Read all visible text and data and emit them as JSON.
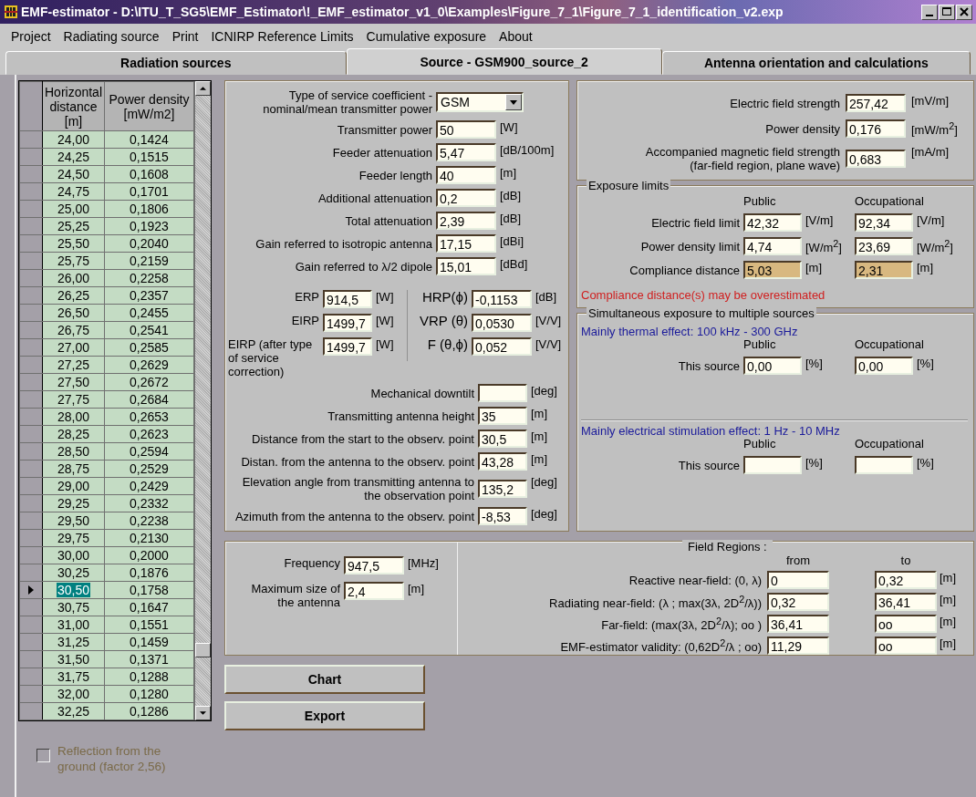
{
  "window": {
    "title": "EMF-estimator - D:\\ITU_T_SG5\\EMF_Estimator\\!_EMF_estimator_v1_0\\Examples\\Figure_7_1\\Figure_7_1_identification_v2.exp"
  },
  "menu": [
    "Project",
    "Radiating source",
    "Print",
    "ICNIRP Reference Limits",
    "Cumulative exposure",
    "About"
  ],
  "tabs": [
    {
      "label": "Radiation sources",
      "selected": false
    },
    {
      "label": "Source - GSM900_source_2",
      "selected": true
    },
    {
      "label": "Antenna orientation and calculations",
      "selected": false
    }
  ],
  "distance_table": {
    "columns": [
      "Horizontal distance [m]",
      "Power density [mW/m2]"
    ],
    "rows": [
      {
        "distance": "24,00",
        "power_density": "0,1424",
        "selected": false
      },
      {
        "distance": "24,25",
        "power_density": "0,1515",
        "selected": false
      },
      {
        "distance": "24,50",
        "power_density": "0,1608",
        "selected": false
      },
      {
        "distance": "24,75",
        "power_density": "0,1701",
        "selected": false
      },
      {
        "distance": "25,00",
        "power_density": "0,1806",
        "selected": false
      },
      {
        "distance": "25,25",
        "power_density": "0,1923",
        "selected": false
      },
      {
        "distance": "25,50",
        "power_density": "0,2040",
        "selected": false
      },
      {
        "distance": "25,75",
        "power_density": "0,2159",
        "selected": false
      },
      {
        "distance": "26,00",
        "power_density": "0,2258",
        "selected": false
      },
      {
        "distance": "26,25",
        "power_density": "0,2357",
        "selected": false
      },
      {
        "distance": "26,50",
        "power_density": "0,2455",
        "selected": false
      },
      {
        "distance": "26,75",
        "power_density": "0,2541",
        "selected": false
      },
      {
        "distance": "27,00",
        "power_density": "0,2585",
        "selected": false
      },
      {
        "distance": "27,25",
        "power_density": "0,2629",
        "selected": false
      },
      {
        "distance": "27,50",
        "power_density": "0,2672",
        "selected": false
      },
      {
        "distance": "27,75",
        "power_density": "0,2684",
        "selected": false
      },
      {
        "distance": "28,00",
        "power_density": "0,2653",
        "selected": false
      },
      {
        "distance": "28,25",
        "power_density": "0,2623",
        "selected": false
      },
      {
        "distance": "28,50",
        "power_density": "0,2594",
        "selected": false
      },
      {
        "distance": "28,75",
        "power_density": "0,2529",
        "selected": false
      },
      {
        "distance": "29,00",
        "power_density": "0,2429",
        "selected": false
      },
      {
        "distance": "29,25",
        "power_density": "0,2332",
        "selected": false
      },
      {
        "distance": "29,50",
        "power_density": "0,2238",
        "selected": false
      },
      {
        "distance": "29,75",
        "power_density": "0,2130",
        "selected": false
      },
      {
        "distance": "30,00",
        "power_density": "0,2000",
        "selected": false
      },
      {
        "distance": "30,25",
        "power_density": "0,1876",
        "selected": false
      },
      {
        "distance": "30,50",
        "power_density": "0,1758",
        "selected": true
      },
      {
        "distance": "30,75",
        "power_density": "0,1647",
        "selected": false
      },
      {
        "distance": "31,00",
        "power_density": "0,1551",
        "selected": false
      },
      {
        "distance": "31,25",
        "power_density": "0,1459",
        "selected": false
      },
      {
        "distance": "31,50",
        "power_density": "0,1371",
        "selected": false
      },
      {
        "distance": "31,75",
        "power_density": "0,1288",
        "selected": false
      },
      {
        "distance": "32,00",
        "power_density": "0,1280",
        "selected": false
      },
      {
        "distance": "32,25",
        "power_density": "0,1286",
        "selected": false
      }
    ]
  },
  "reflection_checkbox": {
    "label": "Reflection from the ground (factor 2,56)",
    "checked": false,
    "disabled": true
  },
  "source_parameters": {
    "service_type": {
      "label": "Type of service coefficient - nominal/mean transmitter power",
      "value": "GSM"
    },
    "fields": [
      {
        "label": "Transmitter power",
        "value": "50",
        "unit": "[W]"
      },
      {
        "label": "Feeder attenuation",
        "value": "5,47",
        "unit": "[dB/100m]"
      },
      {
        "label": "Feeder length",
        "value": "40",
        "unit": "[m]"
      },
      {
        "label": "Additional attenuation",
        "value": "0,2",
        "unit": "[dB]"
      },
      {
        "label": "Total attenuation",
        "value": "2,39",
        "unit": "[dB]"
      },
      {
        "label": "Gain referred to isotropic antenna",
        "value": "17,15",
        "unit": "[dBi]"
      },
      {
        "label": "Gain referred to λ/2 dipole",
        "value": "15,01",
        "unit": "[dBd]"
      }
    ],
    "radiated_power": [
      {
        "label": "ERP",
        "value": "914,5",
        "unit": "[W]"
      },
      {
        "label": "EIRP",
        "value": "1499,7",
        "unit": "[W]"
      },
      {
        "label": "EIRP (after type of service correction)",
        "value": "1499,7",
        "unit": "[W]"
      }
    ],
    "patterns": [
      {
        "label": "HRP(ϕ)",
        "value": "-0,1153",
        "unit": "[dB]"
      },
      {
        "label": "VRP (θ)",
        "value": "0,0530",
        "unit": "[V/V]"
      },
      {
        "label": "F (θ,ϕ)",
        "value": "0,052",
        "unit": "[V/V]"
      }
    ],
    "geometry": [
      {
        "label": "Mechanical downtilt",
        "unit": "[deg]"
      },
      {
        "label": "Transmitting antenna height",
        "value": "35",
        "unit": "[m]"
      },
      {
        "label": "Distance from the start to the observ. point",
        "value": "30,5",
        "unit": "[m]"
      },
      {
        "label": "Distan. from the antenna to the observ. point",
        "value": "43,28",
        "unit": "[m]"
      },
      {
        "label": "Elevation angle from transmitting antenna to the observation point",
        "value": "135,2",
        "unit": "[deg]"
      },
      {
        "label": "Azimuth from the antenna to the observ. point",
        "value": "-8,53",
        "unit": "[deg]"
      }
    ]
  },
  "results": [
    {
      "label": "Electric field strength",
      "value": "257,42",
      "unit": "[mV/m]"
    },
    {
      "label": "Power density",
      "value": "0,176",
      "unit": "[mW/m$^{2}$]"
    },
    {
      "label": "Accompanied magnetic field strength (far-field region, plane wave)",
      "value": "0,683",
      "unit": "[mA/m]"
    }
  ],
  "exposure_limits": {
    "title": "Exposure limits",
    "columns": [
      "Public",
      "Occupational"
    ],
    "rows": [
      {
        "label": "Electric field limit",
        "public": {
          "value": "42,32",
          "unit": "[V/m]",
          "highlighted": false
        },
        "occupational": {
          "value": "92,34",
          "unit": "[V/m]",
          "highlighted": false
        }
      },
      {
        "label": "Power density limit",
        "public": {
          "value": "4,74",
          "unit": "[W/m$^{2}$]",
          "highlighted": false
        },
        "occupational": {
          "value": "23,69",
          "unit": "[W/m$^{2}$]",
          "highlighted": false
        }
      },
      {
        "label": "Compliance distance",
        "public": {
          "value": "5,03",
          "unit": "[m]",
          "highlighted": true
        },
        "occupational": {
          "value": "2,31",
          "unit": "[m]",
          "highlighted": true
        }
      }
    ],
    "warning": "Compliance distance(s) may be overestimated"
  },
  "simultaneous_exposure": {
    "title": "Simultaneous exposure to multiple sources",
    "sections": [
      {
        "title": "Mainly thermal effect: 100 kHz - 300 GHz",
        "columns": [
          "Public",
          "Occupational"
        ],
        "row_label": "This source",
        "public": {
          "value": "0,00",
          "unit": "[%]"
        },
        "occupational": {
          "value": "0,00",
          "unit": "[%]"
        }
      },
      {
        "title": "Mainly electrical stimulation effect: 1 Hz - 10 MHz",
        "columns": [
          "Public",
          "Occupational"
        ],
        "row_label": "This source",
        "public": {
          "unit": "[%]"
        },
        "occupational": {
          "unit": "[%]"
        }
      }
    ]
  },
  "antenna": [
    {
      "label": "Frequency",
      "value": "947,5",
      "unit": "[MHz]"
    },
    {
      "label": "Maximum size of the antenna",
      "value": "2,4",
      "unit": "[m]"
    }
  ],
  "field_regions": {
    "title": "Field Regions :",
    "columns": [
      "from",
      "to"
    ],
    "rows": [
      {
        "label": "Reactive near-field: (0, λ)",
        "from": "0",
        "to": "0,32",
        "unit": "[m]"
      },
      {
        "label": "Radiating near-field: (λ ; max(3λ, 2D$^{2}$/λ))",
        "from": "0,32",
        "to": "36,41",
        "unit": "[m]"
      },
      {
        "label": "Far-field: (max(3λ, 2D$^{2}$/λ); oo )",
        "from": "36,41",
        "to": "oo",
        "unit": "[m]"
      },
      {
        "label": "EMF-estimator validity: (0,62D$^{2}$/λ ; oo)",
        "from": "11,29",
        "to": "oo",
        "unit": "[m]"
      }
    ]
  },
  "buttons": [
    "Chart",
    "Export"
  ]
}
